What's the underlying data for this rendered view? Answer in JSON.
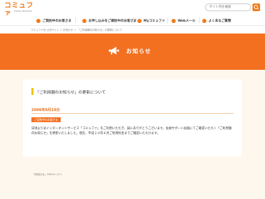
{
  "header": {
    "logo_text": "コミュファ",
    "logo_sub": "Home Network",
    "search_placeholder": "サイト内を検索"
  },
  "nav": {
    "items": [
      {
        "label": "ご契約中のお客さま"
      },
      {
        "label": "お申し込みをご検討中のお客さま"
      },
      {
        "label": "Myコミュファ"
      },
      {
        "label": "Webメール"
      },
      {
        "label": "よくあるご質問"
      }
    ]
  },
  "breadcrumb": "コミュファ光 公式サイト ＞ お知らせ ＞ 「ご利用額のお知らせ」の更新について",
  "banner": {
    "title": "お知らせ"
  },
  "notice": {
    "title": "「ご利用額のお知らせ」の更新について",
    "date": "2006年9月19日",
    "tag": "ご契約中のお客さま",
    "body": "日頃より光インターネットサービス「コミュファ」をご利用いただき、誠にありがとうございます。会員サポート画面にてご確認いただく「ご利用額のお知らせ」を更新いたしました。現在、平成１８年８月ご利用料金までご確認いただけます。"
  },
  "footer_link": "「お知らせ」TOPページへ",
  "colors": {
    "accent": "#f37021",
    "date": "#e8711d",
    "title_bar": "#f1c400"
  }
}
